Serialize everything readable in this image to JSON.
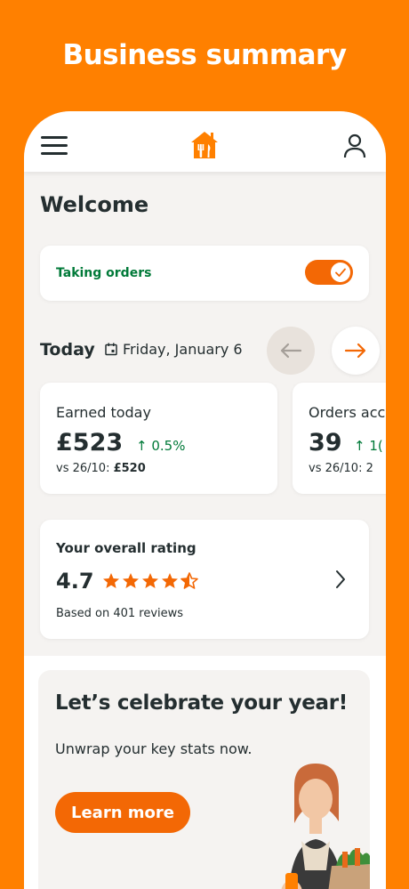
{
  "promo": {
    "title": "Business summary"
  },
  "header": {
    "menu_icon": "hamburger-menu-icon",
    "logo_icon": "house-fork-knife-logo",
    "profile_icon": "user-profile-icon"
  },
  "welcome": "Welcome",
  "orders_toggle": {
    "label": "Taking orders",
    "on": true
  },
  "today": {
    "label": "Today",
    "date": "Friday, January 6"
  },
  "stats": [
    {
      "label": "Earned today",
      "value": "£523",
      "change": "↑ 0.5%",
      "compare_prefix": "vs 26/10: ",
      "compare_value": "£520"
    },
    {
      "label": "Orders acc",
      "value": "39",
      "change": "↑ 1(",
      "compare_prefix": "vs 26/10: 2",
      "compare_value": ""
    }
  ],
  "rating": {
    "title": "Your overall rating",
    "value": "4.7",
    "stars": 4.5,
    "reviews": "Based on 401 reviews"
  },
  "celebrate": {
    "title": "Let’s celebrate your year!",
    "subtitle": "Unwrap your key stats now.",
    "button": "Learn more"
  },
  "colors": {
    "brand_orange": "#FF8000",
    "accent": "#F36805",
    "positive_green": "#017A39",
    "text": "#242E30",
    "surface": "#F5F3F1"
  }
}
